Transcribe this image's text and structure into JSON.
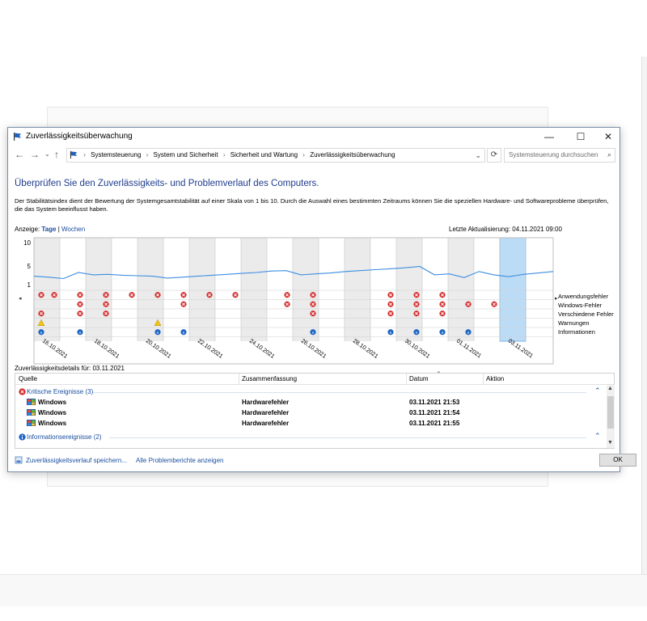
{
  "window": {
    "title": "Zuverlässigkeitsüberwachung",
    "minimize": "—",
    "maximize": "☐",
    "close": "✕"
  },
  "address": {
    "crumbs": [
      "Systemsteuerung",
      "System und Sicherheit",
      "Sicherheit und Wartung",
      "Zuverlässigkeitsüberwachung"
    ],
    "search_placeholder": "Systemsteuerung durchsuchen"
  },
  "page": {
    "heading": "Überprüfen Sie den Zuverlässigkeits- und Problemverlauf des Computers.",
    "description": "Der Stabilitätsindex dient der Bewertung der Systemgesamtstabilität auf einer Skala von 1 bis 10. Durch die Auswahl eines bestimmten Zeitraums können Sie die speziellen Hardware- und Softwareprobleme überprüfen, die das System beeinflusst haben.",
    "view_label": "Anzeige:",
    "view_days": "Tage",
    "view_sep": "|",
    "view_weeks": "Wochen",
    "last_update": "Letzte Aktualisierung: 04.11.2021 09:00"
  },
  "chart_data": {
    "type": "line",
    "y_ticks": [
      "10",
      "5",
      "1"
    ],
    "ylim": [
      1,
      10
    ],
    "date_labels": [
      "16.10.2021",
      "18.10.2021",
      "20.10.2021",
      "22.10.2021",
      "24.10.2021",
      "26.10.2021",
      "28.10.2021",
      "30.10.2021",
      "01.11.2021",
      "03.11.2021"
    ],
    "stability": [
      2.8,
      2.6,
      2.3,
      3.6,
      3.1,
      3.2,
      3.0,
      2.9,
      2.8,
      2.4,
      2.6,
      2.8,
      3.0,
      3.2,
      3.4,
      3.6,
      3.9,
      4.0,
      3.1,
      3.3,
      3.5,
      3.8,
      4.0,
      4.2,
      4.4,
      4.6,
      4.9,
      3.1,
      3.3,
      2.5,
      3.8,
      3.1,
      2.7,
      3.2,
      3.5,
      3.8
    ],
    "selected_index": 18,
    "legend": [
      "Anwendungsfehler",
      "Windows-Fehler",
      "Verschiedene Fehler",
      "Warnungen",
      "Informationen"
    ],
    "events": {
      "app_errors": [
        0,
        1,
        3,
        5,
        7,
        9,
        11,
        13,
        15,
        19,
        21,
        27,
        29,
        31
      ],
      "windows_errors": [
        3,
        5,
        11,
        19,
        21,
        27,
        29,
        31,
        33,
        35
      ],
      "misc_errors": [
        0,
        3,
        5,
        21,
        27,
        29,
        31
      ],
      "warnings": [
        0,
        9
      ],
      "information": [
        0,
        3,
        9,
        11,
        21,
        27,
        29,
        31,
        33
      ]
    }
  },
  "details": {
    "label": "Zuverlässigkeitsdetails für: 03.11.2021",
    "columns": [
      "Quelle",
      "Zusammenfassung",
      "Datum",
      "Aktion"
    ],
    "groups": [
      {
        "label": "Kritische Ereignisse (3)",
        "rows": [
          {
            "source": "Windows",
            "summary": "Hardwarefehler",
            "date": "03.11.2021 21:53",
            "action": ""
          },
          {
            "source": "Windows",
            "summary": "Hardwarefehler",
            "date": "03.11.2021 21:54",
            "action": ""
          },
          {
            "source": "Windows",
            "summary": "Hardwarefehler",
            "date": "03.11.2021 21:55",
            "action": ""
          }
        ]
      },
      {
        "label": "Informationsereignisse (2)",
        "rows": []
      }
    ]
  },
  "footer": {
    "save_link": "Zuverlässigkeitsverlauf speichern...",
    "reports_link": "Alle Problemberichte anzeigen",
    "ok": "OK"
  },
  "colors": {
    "heading": "#1e3c8c",
    "link": "#1a4fa0",
    "line": "#3c8ee0",
    "error": "#d42b2b",
    "info": "#1f66c4",
    "warning": "#f0c419",
    "selected": "#bcdcf6"
  }
}
